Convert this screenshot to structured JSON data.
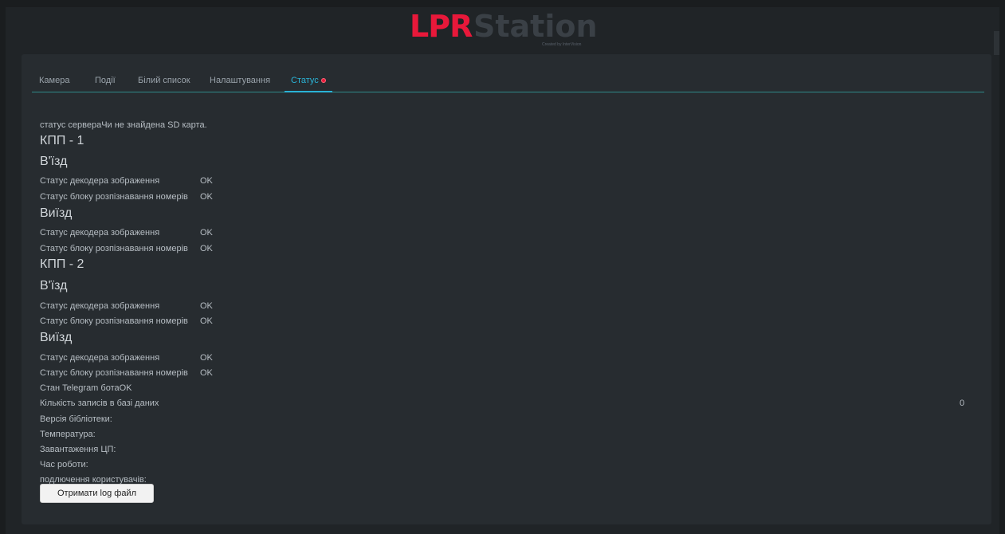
{
  "logo": {
    "part1": "LPR",
    "part2": "Station",
    "sub": "Created by InterVision"
  },
  "tabs": [
    {
      "label": "Камера"
    },
    {
      "label": "Події"
    },
    {
      "label": "Білий список"
    },
    {
      "label": "Налаштування"
    },
    {
      "label": "Статус"
    }
  ],
  "status": {
    "server_label": "статус сервера",
    "server_value": "Чи не знайдена SD карта.",
    "kpp1": {
      "title": "КПП - 1",
      "entry": {
        "title": "В'їзд",
        "decoder_label": "Статус декодера зображення",
        "decoder_value": "OK",
        "lpr_label": "Статус блоку розпізнавання номерів",
        "lpr_value": "OK"
      },
      "exit": {
        "title": "Виїзд",
        "decoder_label": "Статус декодера зображення",
        "decoder_value": "OK",
        "lpr_label": "Статус блоку розпізнавання номерів",
        "lpr_value": "OK"
      }
    },
    "kpp2": {
      "title": "КПП - 2",
      "entry": {
        "title": "В'їзд",
        "decoder_label": "Статус декодера зображення",
        "decoder_value": "OK",
        "lpr_label": "Статус блоку розпізнавання номерів",
        "lpr_value": "OK"
      },
      "exit": {
        "title": "Виїзд",
        "decoder_label": "Статус декодера зображення",
        "decoder_value": "OK",
        "lpr_label": "Статус блоку розпізнавання номерів",
        "lpr_value": "OK"
      }
    },
    "telegram_label": "Стан Telegram бота",
    "telegram_value": "OK",
    "db_label": "Кількість записів в базі даних",
    "db_value": "0",
    "library_label": "Версія бібліотеки:",
    "temp_label": "Температура:",
    "cpu_label": "Завантаження ЦП:",
    "uptime_label": "Час роботи:",
    "users_label": "подлючення користувачів:"
  },
  "button": {
    "log": "Отримати log файл"
  },
  "colors": {
    "accent": "#2ab3d6",
    "brand": "#e8183a",
    "background": "#202427"
  }
}
